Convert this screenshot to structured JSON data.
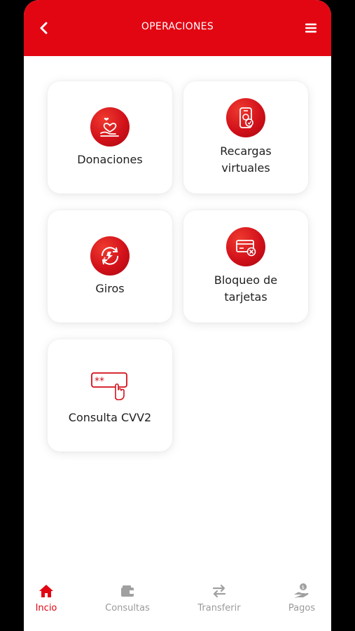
{
  "header": {
    "title": "OPERACIONES",
    "back_icon": "chevron-left-icon",
    "menu_icon": "hamburger-menu-icon"
  },
  "operations": [
    {
      "label_lines": [
        "Donaciones"
      ],
      "icon": "donation-heart-icon"
    },
    {
      "label_lines": [
        "Recargas",
        "virtuales"
      ],
      "icon": "phone-recharge-icon"
    },
    {
      "label_lines": [
        "Giros"
      ],
      "icon": "money-transfer-icon"
    },
    {
      "label_lines": [
        "Bloqueo de",
        "tarjetas"
      ],
      "icon": "card-block-icon"
    },
    {
      "label_lines": [
        "Consulta CVV2"
      ],
      "icon": "cvv-finger-icon"
    }
  ],
  "bottom_nav": [
    {
      "label": "Incio",
      "icon": "home-icon",
      "active": true
    },
    {
      "label": "Consultas",
      "icon": "wallet-icon",
      "active": false
    },
    {
      "label": "Transferir",
      "icon": "transfer-arrows-icon",
      "active": false
    },
    {
      "label": "Pagos",
      "icon": "payment-hand-icon",
      "active": false
    }
  ],
  "colors": {
    "brand_red": "#e20613",
    "active_nav": "#e20613",
    "inactive_nav": "#9a9a9a"
  }
}
